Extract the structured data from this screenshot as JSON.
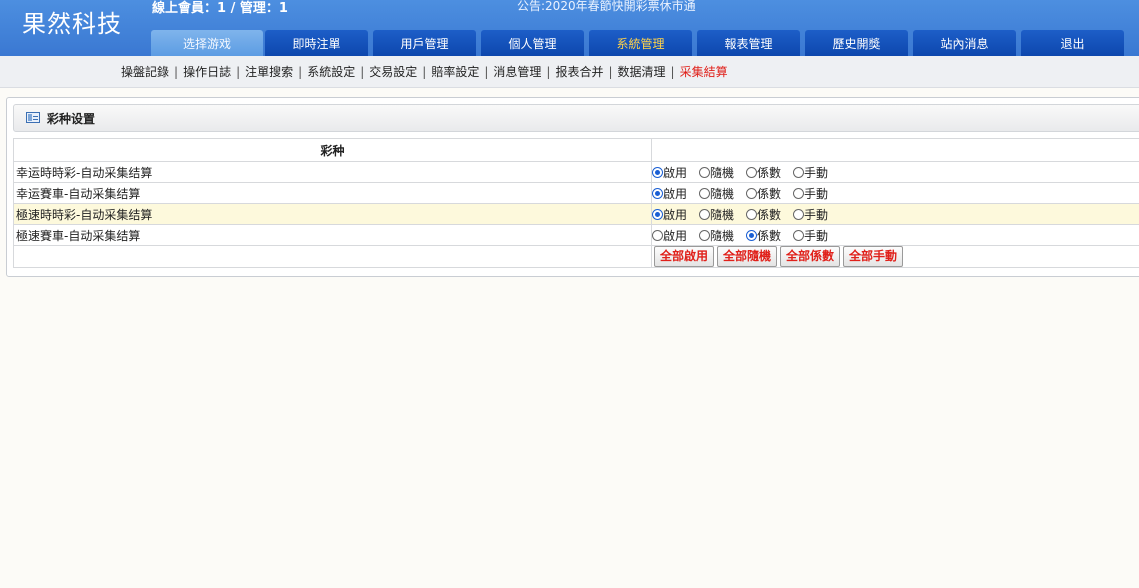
{
  "header": {
    "logo": "果然科技",
    "online": "線上會員：1 / 管理：1",
    "notice": "公告:2020年春節快開彩票休市通"
  },
  "nav": {
    "tabs": [
      "选择游戏",
      "即時注單",
      "用戶管理",
      "個人管理",
      "系統管理",
      "報表管理",
      "歷史開獎",
      "站內消息",
      "退出"
    ],
    "active_index": 4
  },
  "subnav": {
    "items": [
      "操盤記錄",
      "操作日誌",
      "注單搜索",
      "系統設定",
      "交易設定",
      "賠率設定",
      "消息管理",
      "报表合并",
      "数据清理",
      "采集結算"
    ],
    "active_index": 9
  },
  "panel": {
    "title": "彩种设置",
    "column_header": "彩种",
    "option_labels": [
      "啟用",
      "隨機",
      "係數",
      "手動"
    ],
    "rows": [
      {
        "name": "幸运時時彩-自动采集结算",
        "selected": 0,
        "highlight": false
      },
      {
        "name": "幸运賽車-自动采集结算",
        "selected": 0,
        "highlight": false
      },
      {
        "name": "極速時時彩-自动采集结算",
        "selected": 0,
        "highlight": true
      },
      {
        "name": "極速賽車-自动采集结算",
        "selected": 2,
        "highlight": false
      }
    ],
    "buttons": [
      "全部啟用",
      "全部隨機",
      "全部係數",
      "全部手動"
    ]
  },
  "colors": {
    "header_blue": "#3a78d2",
    "tab_blue": "#0d47ad",
    "active_tab_text": "#ffd24a",
    "alert_red": "#e0201a",
    "row_highlight": "#fdf9dc"
  }
}
